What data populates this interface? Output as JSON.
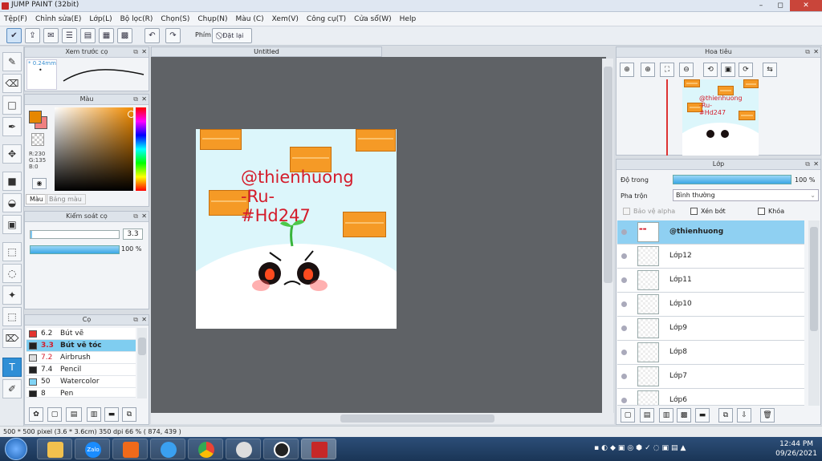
{
  "window": {
    "title": "JUMP PAINT (32bit)",
    "min": "–",
    "max": "◻",
    "close": "✕"
  },
  "menu": [
    "Tệp(F)",
    "Chỉnh sửa(E)",
    "Lớp(L)",
    "Bộ lọc(R)",
    "Chọn(S)",
    "Chụp(N)",
    "Màu (C)",
    "Xem(V)",
    "Công cụ(T)",
    "Cửa sổ(W)",
    "Help"
  ],
  "toolbar": {
    "keys_label": "Phím",
    "reset_label": "Đặt lại"
  },
  "preview": {
    "title": "Xem trước cọ",
    "size": "* 0.24mm",
    "dot": "•"
  },
  "color": {
    "title": "Màu",
    "r": "R:230",
    "g": "G:135",
    "b": "B:0",
    "tab_color": "Màu",
    "tab_palette": "Bảng màu",
    "main": "#e68700"
  },
  "brush_ctrl": {
    "title": "Kiểm soát cọ",
    "size": "3.3",
    "opacity": "100 %"
  },
  "brushes": {
    "title": "Cọ",
    "items": [
      {
        "size": "6.2",
        "name": "Bút vẽ",
        "color": "#e3342f"
      },
      {
        "size": "3.3",
        "name": "Bút vẽ tóc",
        "color": "#222222"
      },
      {
        "size": "7.2",
        "name": "Airbrush",
        "color": "#dddddd"
      },
      {
        "size": "7.4",
        "name": "Pencil",
        "color": "#222222"
      },
      {
        "size": "50",
        "name": "Watercolor",
        "color": "#7fd3f5"
      },
      {
        "size": "8",
        "name": "Pen",
        "color": "#222222"
      }
    ]
  },
  "document": {
    "tab": "Untitled",
    "watermark": [
      "@thienhuong",
      "-Ru-",
      "#Hd247"
    ]
  },
  "navigator": {
    "title": "Hoa tiêu",
    "watermark": [
      "@thienhuong",
      "-Ru-",
      "#Hd247"
    ]
  },
  "layers": {
    "title": "Lớp",
    "opacity_label": "Độ trong",
    "opacity_value": "100 %",
    "blend_label": "Pha trộn",
    "blend_value": "Bình thường",
    "protect_alpha": "Bảo vệ alpha",
    "clip": "Xén bớt",
    "lock": "Khóa",
    "items": [
      "@thienhuong",
      "Lớp12",
      "Lớp11",
      "Lớp10",
      "Lớp9",
      "Lớp8",
      "Lớp7",
      "Lớp6"
    ]
  },
  "status": {
    "text": "500 * 500 pixel  (3.6 * 3.6cm)  350 dpi  66 %  ( 874, 439 )"
  },
  "taskbar": {
    "time": "12:44 PM",
    "date": "09/26/2021",
    "zalo": "Zalo"
  }
}
